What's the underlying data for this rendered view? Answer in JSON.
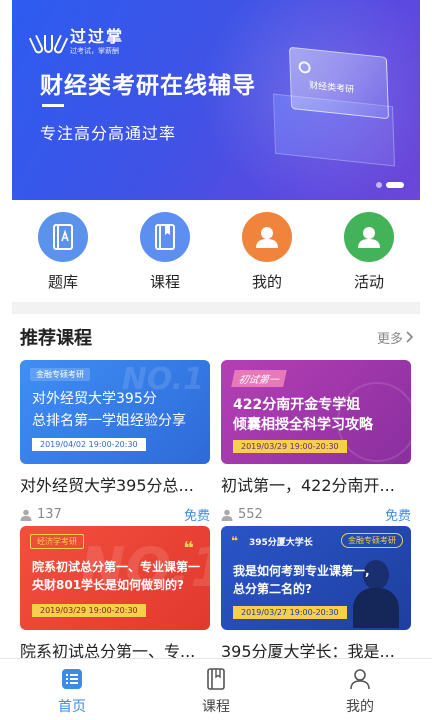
{
  "banner": {
    "logo_name": "过过掌",
    "logo_slogan": "过考试，掌薪酬",
    "title": "财经类考研在线辅导",
    "subtitle": "专注高分高通过率",
    "card_text": "财经类考研",
    "slide_count": 2,
    "active_slide": 2
  },
  "quicknav": [
    {
      "label": "题库",
      "icon": "question-bank-icon",
      "color": "#5b93ec"
    },
    {
      "label": "课程",
      "icon": "course-book-icon",
      "color": "#5d8ff0"
    },
    {
      "label": "我的",
      "icon": "user-icon",
      "color": "#f0843c"
    },
    {
      "label": "活动",
      "icon": "activity-user-icon",
      "color": "#43b35a"
    }
  ],
  "section": {
    "title": "推荐课程",
    "more": "更多"
  },
  "courses": [
    {
      "tag": "金融专硕考研",
      "thumb_line1": "对外经贸大学395分",
      "thumb_line2": "总排名第一学姐经验分享",
      "date": "2019/04/02  19:00-20:30",
      "title": "对外经贸大学395分总...",
      "views": "137",
      "price": "免费"
    },
    {
      "tag": "初试第一",
      "thumb_line1": "422分南开金专学姐",
      "thumb_line2": "倾囊相授全科学习攻略",
      "date": "2019/03/29  19:00-20:30",
      "title": "初试第一，422分南开...",
      "views": "552",
      "price": "免费"
    },
    {
      "tag": "经济学考研",
      "thumb_line1": "院系初试总分第一、专业课第一",
      "thumb_line2": "央财801学长是如何做到的?",
      "date": "2019/03/29  19:00-20:30",
      "title": "院系初试总分第一、专...",
      "views": "",
      "price": ""
    },
    {
      "tag": "金融专硕考研",
      "tag2": "395分厦大学长",
      "thumb_line1": "我是如何考到专业课第一,",
      "thumb_line2": "总分第二名的?",
      "date": "2019/03/27  19:00-20:30",
      "title": "395分厦大学长：我是...",
      "views": "",
      "price": ""
    }
  ],
  "tabbar": [
    {
      "label": "首页",
      "icon": "home-list-icon",
      "active": true
    },
    {
      "label": "课程",
      "icon": "course-book-icon",
      "active": false
    },
    {
      "label": "我的",
      "icon": "profile-icon",
      "active": false
    }
  ],
  "colors": {
    "accent": "#3c8ce7",
    "banner_start": "#2d5cf0",
    "banner_end": "#6c46d8"
  }
}
